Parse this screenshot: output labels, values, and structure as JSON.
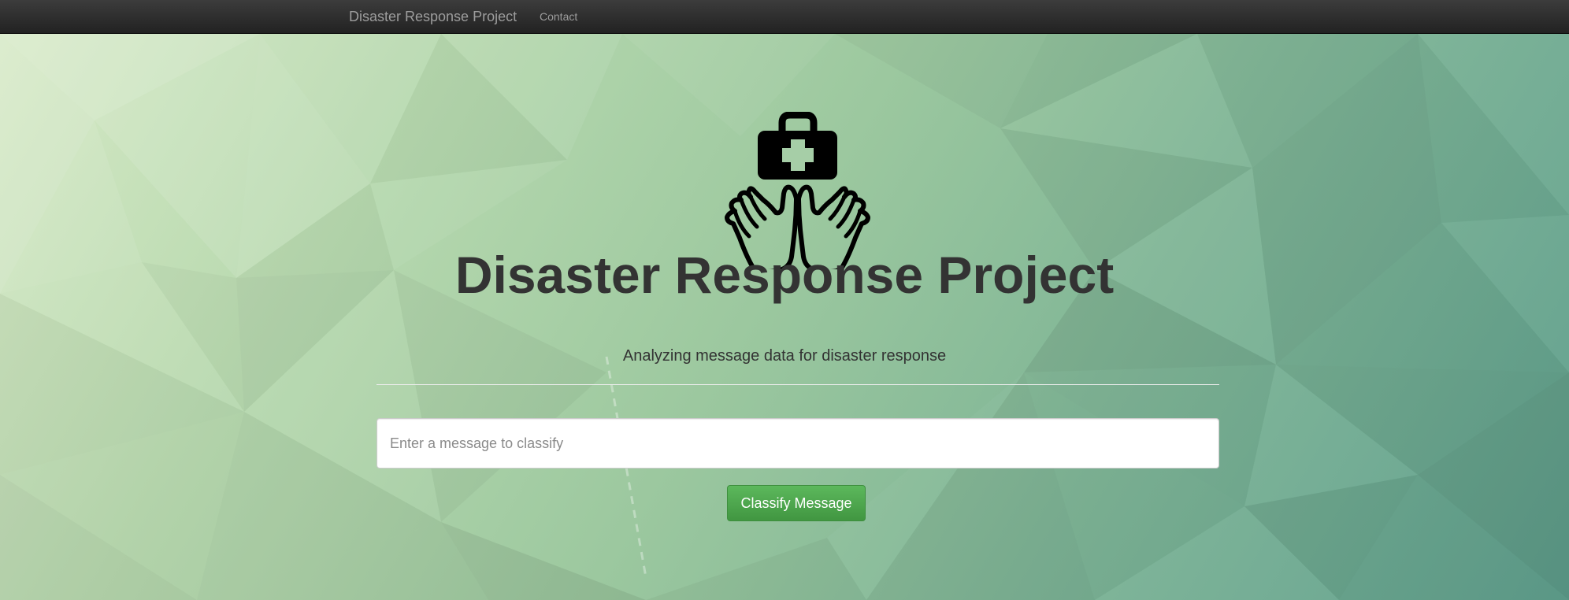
{
  "navbar": {
    "brand": "Disaster Response Project",
    "links": [
      {
        "label": "Contact"
      }
    ]
  },
  "hero": {
    "logo_icon": "medical-aid-hands-icon",
    "title": "Disaster Response Project",
    "subtitle": "Analyzing message data for disaster response"
  },
  "form": {
    "query": {
      "value": "",
      "placeholder": "Enter a message to classify"
    },
    "submit_label": "Classify Message"
  },
  "colors": {
    "navbar_bg": "#222222",
    "nav_text": "#9d9d9d",
    "title_text": "#333333",
    "button_green": "#5cb85c",
    "background_light": "#d6e9c6",
    "background_dark": "#5e9e8c"
  }
}
